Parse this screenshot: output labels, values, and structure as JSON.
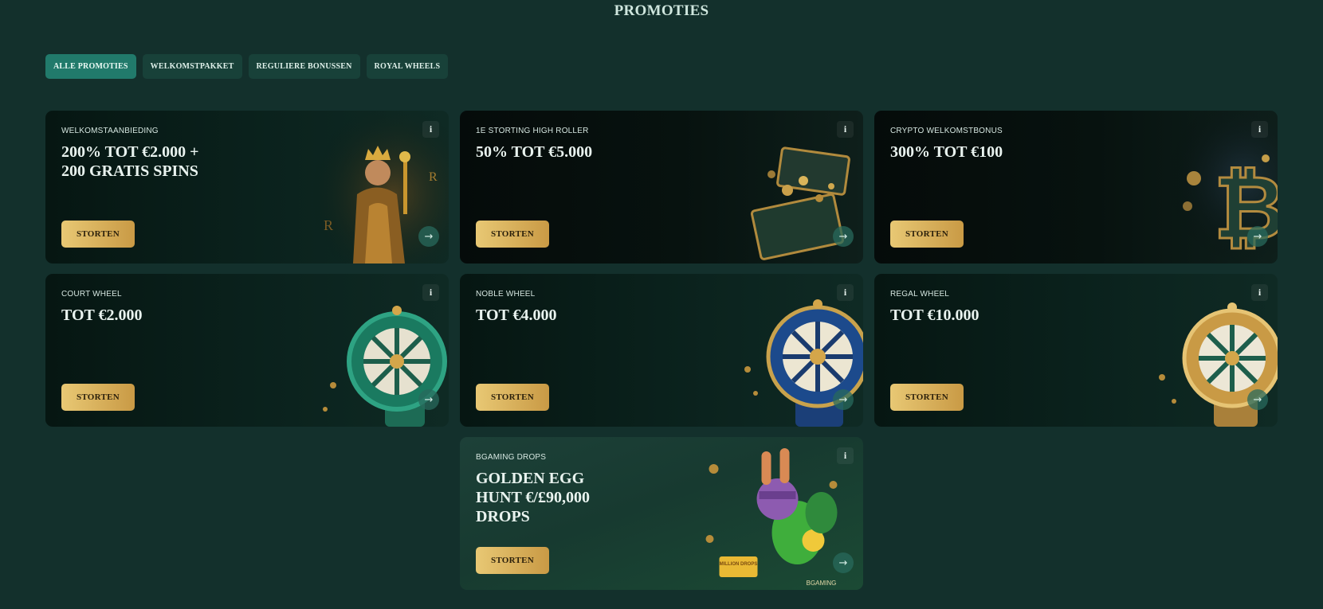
{
  "header": {
    "title": "PROMOTIES"
  },
  "tabs": [
    {
      "label": "ALLE PROMOTIES",
      "active": true
    },
    {
      "label": "WELKOMSTPAKKET",
      "active": false
    },
    {
      "label": "REGULIERE BONUSSEN",
      "active": false
    },
    {
      "label": "ROYAL WHEELS",
      "active": false
    }
  ],
  "cards": [
    {
      "label": "WELKOMSTAANBIEDING",
      "headline": "200% TOT €2.000 + 200 GRATIS SPINS",
      "button": "STORTEN",
      "info": "i",
      "arrow": "→",
      "art": "king-illustration"
    },
    {
      "label": "1E STORTING HIGH ROLLER",
      "headline": "50% TOT €5.000",
      "button": "STORTEN",
      "info": "i",
      "arrow": "→",
      "art": "treasure-chest-illustration"
    },
    {
      "label": "CRYPTO WELKOMSTBONUS",
      "headline": "300% TOT €100",
      "button": "STORTEN",
      "info": "i",
      "arrow": "→",
      "art": "bitcoin-illustration"
    },
    {
      "label": "COURT WHEEL",
      "headline": "TOT €2.000",
      "button": "STORTEN",
      "info": "i",
      "arrow": "→",
      "art": "green-wheel-illustration"
    },
    {
      "label": "NOBLE WHEEL",
      "headline": "TOT €4.000",
      "button": "STORTEN",
      "info": "i",
      "arrow": "→",
      "art": "blue-wheel-illustration"
    },
    {
      "label": "REGAL WHEEL",
      "headline": "TOT €10.000",
      "button": "STORTEN",
      "info": "i",
      "arrow": "→",
      "art": "gold-wheel-illustration"
    },
    {
      "label": "BGAMING DROPS",
      "headline": "GOLDEN EGG HUNT €/£90,000 DROPS",
      "button": "STORTEN",
      "info": "i",
      "arrow": "→",
      "art": "rabbit-illustration",
      "art_text": [
        "MILLION DROPS",
        "BGAMING"
      ]
    }
  ],
  "colors": {
    "background": "#13302c",
    "tab": "#184139",
    "tab_active": "#217a6b",
    "button_gold_start": "#e8c874",
    "button_gold_end": "#c99a45"
  }
}
